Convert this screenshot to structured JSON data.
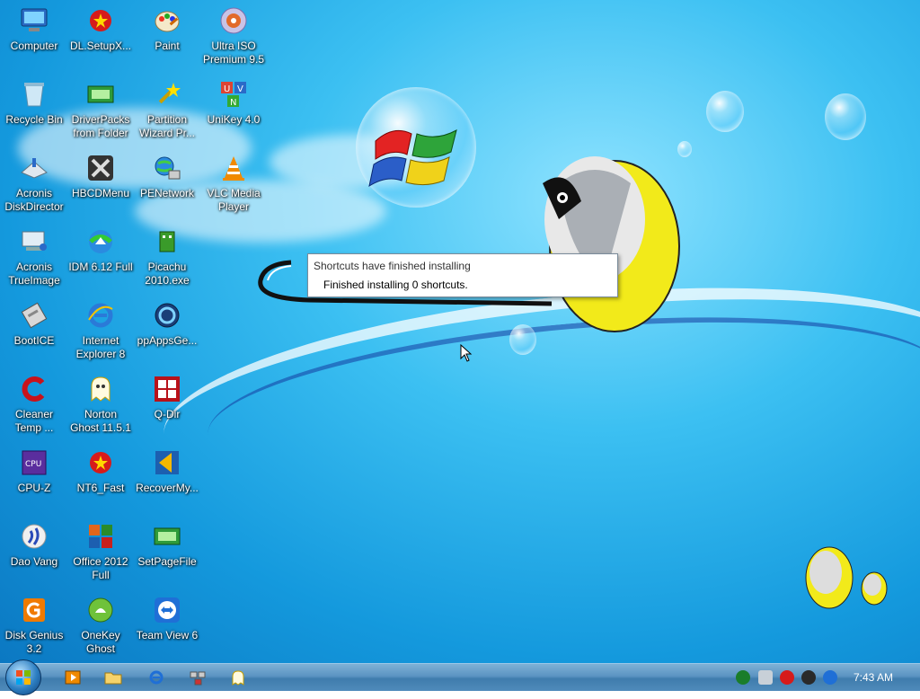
{
  "desktop": {
    "icons": [
      {
        "label": "Computer",
        "icon": "computer-icon"
      },
      {
        "label": "DL.SetupX...",
        "icon": "setup-icon"
      },
      {
        "label": "Paint",
        "icon": "paint-icon"
      },
      {
        "label": "Ultra ISO\nPremium 9.5",
        "icon": "disc-icon"
      },
      {
        "label": "Recycle Bin",
        "icon": "recycle-bin-icon"
      },
      {
        "label": "DriverPacks\nfrom Folder",
        "icon": "driver-icon"
      },
      {
        "label": "Partition\nWizard Pr...",
        "icon": "wizard-icon"
      },
      {
        "label": "UniKey 4.0",
        "icon": "unikey-icon"
      },
      {
        "label": "Acronis\nDiskDirector",
        "icon": "disk-director-icon"
      },
      {
        "label": "HBCDMenu",
        "icon": "tools-icon"
      },
      {
        "label": "PENetwork",
        "icon": "network-icon"
      },
      {
        "label": "VLC Media\nPlayer",
        "icon": "vlc-icon"
      },
      {
        "label": "Acronis\nTrueImage",
        "icon": "true-image-icon"
      },
      {
        "label": "IDM 6.12 Full",
        "icon": "idm-icon"
      },
      {
        "label": "Picachu\n2010.exe",
        "icon": "picachu-icon"
      },
      {
        "label": "BootICE",
        "icon": "bootice-icon"
      },
      {
        "label": "Internet\nExplorer 8",
        "icon": "ie-icon"
      },
      {
        "label": "ppAppsGe...",
        "icon": "ppapps-icon"
      },
      {
        "label": "Cleaner\nTemp ...",
        "icon": "ccleaner-icon"
      },
      {
        "label": "Norton\nGhost 11.5.1",
        "icon": "ghost-icon"
      },
      {
        "label": "Q-Dir",
        "icon": "qdir-icon"
      },
      {
        "label": "CPU-Z",
        "icon": "cpuz-icon"
      },
      {
        "label": "NT6_Fast",
        "icon": "nt6-icon"
      },
      {
        "label": "RecoverMy...",
        "icon": "recover-icon"
      },
      {
        "label": "Dao Vang",
        "icon": "dao-vang-icon"
      },
      {
        "label": "Office 2012\nFull",
        "icon": "office-icon"
      },
      {
        "label": "SetPageFile",
        "icon": "pagefile-icon"
      },
      {
        "label": "Disk Genius\n3.2",
        "icon": "diskgenius-icon"
      },
      {
        "label": "OneKey\nGhost",
        "icon": "onekey-icon"
      },
      {
        "label": "Team View 6",
        "icon": "teamviewer-icon"
      }
    ]
  },
  "notification": {
    "title": "Shortcuts have finished installing",
    "message": "Finished installing 0 shortcuts."
  },
  "taskbar": {
    "start_icon": "windows-orb-icon",
    "pinned": [
      "media-player-icon",
      "folder-icon",
      "ie-icon",
      "network-icon",
      "ghost-icon"
    ],
    "tray": [
      "play-icon",
      "tool-icon",
      "flag-icon",
      "eject-icon",
      "globe-icon"
    ],
    "clock": "7:43 AM"
  },
  "colors": {
    "taskbar": "#4f8bbb",
    "desktop_bg": "#1499dd"
  }
}
